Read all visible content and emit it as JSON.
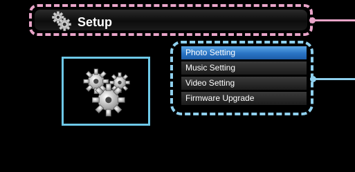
{
  "header": {
    "title": "Setup"
  },
  "menu": {
    "items": [
      {
        "label": "Photo Setting",
        "selected": true
      },
      {
        "label": "Music Setting",
        "selected": false
      },
      {
        "label": "Video Setting",
        "selected": false
      },
      {
        "label": "Firmware Upgrade",
        "selected": false
      }
    ]
  },
  "colors": {
    "header_border": "#e8a4c8",
    "menu_border": "#8fd0ee",
    "preview_border": "#6ec9e8",
    "selected_item": "#2a74c4"
  },
  "icons": {
    "header": "gears-icon",
    "preview": "gears-icon"
  }
}
